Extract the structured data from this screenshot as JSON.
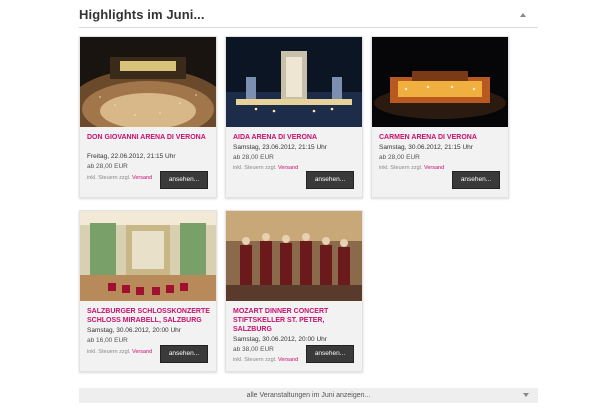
{
  "section": {
    "title": "Highlights im Juni..."
  },
  "cards": [
    {
      "title": "DON GIOVANNI ARENA DI VERONA",
      "date": "Freitag, 22.06.2012, 21:15 Uhr",
      "price": "ab 28,00 EUR",
      "note": "inkl. Steuern zzgl.",
      "note_link": "Versand",
      "button": "ansehen..."
    },
    {
      "title": "AIDA ARENA DI VERONA",
      "date": "Samstag, 23.06.2012, 21:15 Uhr",
      "price": "ab 28,00 EUR",
      "note": "inkl. Steuern zzgl.",
      "note_link": "Versand",
      "button": "ansehen..."
    },
    {
      "title": "CARMEN ARENA DI VERONA",
      "date": "Samstag, 30.06.2012, 21:15 Uhr",
      "price": "ab 28,00 EUR",
      "note": "inkl. Steuern zzgl.",
      "note_link": "Versand",
      "button": "ansehen..."
    },
    {
      "title": "SALZBURGER SCHLOSSKONZERTE SCHLOSS MIRABELL, SALZBURG",
      "date": "Samstag, 30.06.2012, 20:00 Uhr",
      "price": "ab 16,00 EUR",
      "note": "inkl. Steuern zzgl.",
      "note_link": "Versand",
      "button": "ansehen..."
    },
    {
      "title": "MOZART DINNER CONCERT STIFTSKELLER ST. PETER, SALZBURG",
      "date": "Samstag, 30.06.2012, 20:00 Uhr",
      "price": "ab 38,00 EUR",
      "note": "inkl. Steuern zzgl.",
      "note_link": "Versand",
      "button": "ansehen..."
    }
  ],
  "show_all": {
    "label": "alle Veranstaltungen im Juni anzeigen..."
  },
  "colors": {
    "accent": "#c8106e",
    "button_bg": "#3a3a3a",
    "card_bg": "#f2f2f2"
  }
}
